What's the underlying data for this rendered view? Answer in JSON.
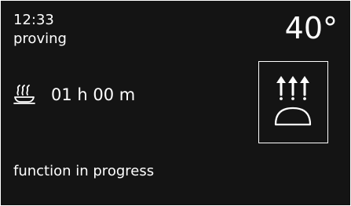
{
  "header": {
    "time": "12:33",
    "mode": "proving",
    "temperature": "40°"
  },
  "timer": {
    "icon": "proving-dough-icon",
    "duration": "01 h 00 m"
  },
  "function_panel": {
    "icon": "proving-function-icon"
  },
  "status": {
    "text": "function in progress"
  },
  "colors": {
    "background": "#141414",
    "foreground": "#ffffff"
  }
}
